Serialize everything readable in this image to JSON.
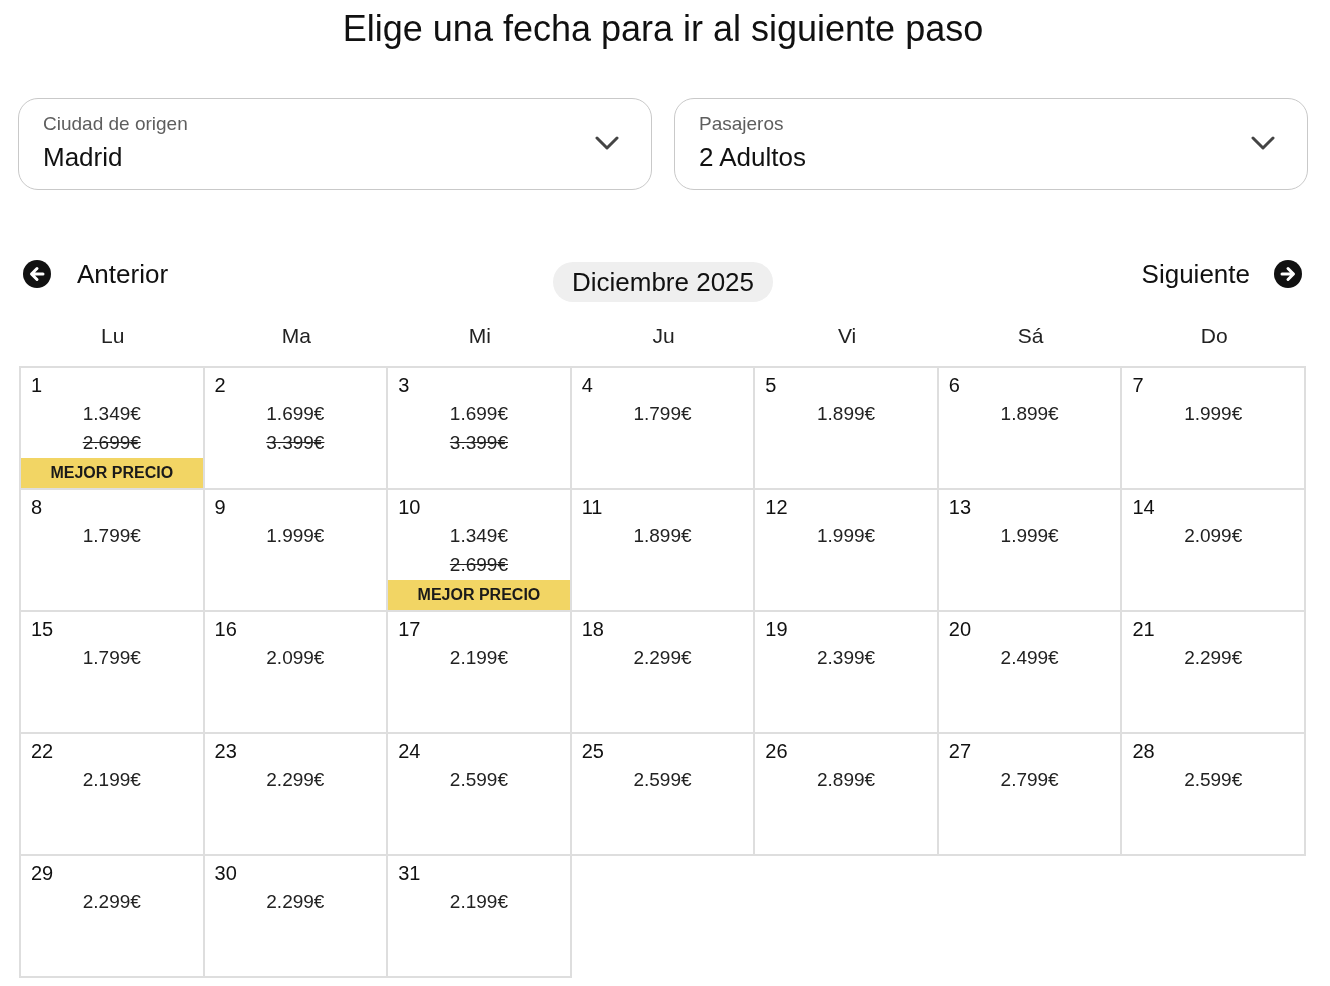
{
  "title": "Elige una fecha para ir al siguiente paso",
  "selectors": [
    {
      "label": "Ciudad de origen",
      "value": "Madrid"
    },
    {
      "label": "Pasajeros",
      "value": "2 Adultos"
    }
  ],
  "calendar": {
    "previous": "Anterior",
    "month": "Diciembre 2025",
    "next": "Siguiente",
    "weekdays": [
      "Lu",
      "Ma",
      "Mi",
      "Ju",
      "Vi",
      "Sá",
      "Do"
    ],
    "days": [
      {
        "day": "1",
        "price": "1.349€",
        "old_price": "2.699€",
        "badge": "MEJOR PRECIO"
      },
      {
        "day": "2",
        "price": "1.699€",
        "old_price": "3.399€"
      },
      {
        "day": "3",
        "price": "1.699€",
        "old_price": "3.399€"
      },
      {
        "day": "4",
        "price": "1.799€"
      },
      {
        "day": "5",
        "price": "1.899€"
      },
      {
        "day": "6",
        "price": "1.899€"
      },
      {
        "day": "7",
        "price": "1.999€"
      },
      {
        "day": "8",
        "price": "1.799€"
      },
      {
        "day": "9",
        "price": "1.999€"
      },
      {
        "day": "10",
        "price": "1.349€",
        "old_price": "2.699€",
        "badge": "MEJOR PRECIO"
      },
      {
        "day": "11",
        "price": "1.899€"
      },
      {
        "day": "12",
        "price": "1.999€"
      },
      {
        "day": "13",
        "price": "1.999€"
      },
      {
        "day": "14",
        "price": "2.099€"
      },
      {
        "day": "15",
        "price": "1.799€"
      },
      {
        "day": "16",
        "price": "2.099€"
      },
      {
        "day": "17",
        "price": "2.199€"
      },
      {
        "day": "18",
        "price": "2.299€"
      },
      {
        "day": "19",
        "price": "2.399€"
      },
      {
        "day": "20",
        "price": "2.499€"
      },
      {
        "day": "21",
        "price": "2.299€"
      },
      {
        "day": "22",
        "price": "2.199€"
      },
      {
        "day": "23",
        "price": "2.299€"
      },
      {
        "day": "24",
        "price": "2.599€"
      },
      {
        "day": "25",
        "price": "2.599€"
      },
      {
        "day": "26",
        "price": "2.899€"
      },
      {
        "day": "27",
        "price": "2.799€"
      },
      {
        "day": "28",
        "price": "2.599€"
      },
      {
        "day": "29",
        "price": "2.299€"
      },
      {
        "day": "30",
        "price": "2.299€"
      },
      {
        "day": "31",
        "price": "2.199€"
      }
    ]
  }
}
